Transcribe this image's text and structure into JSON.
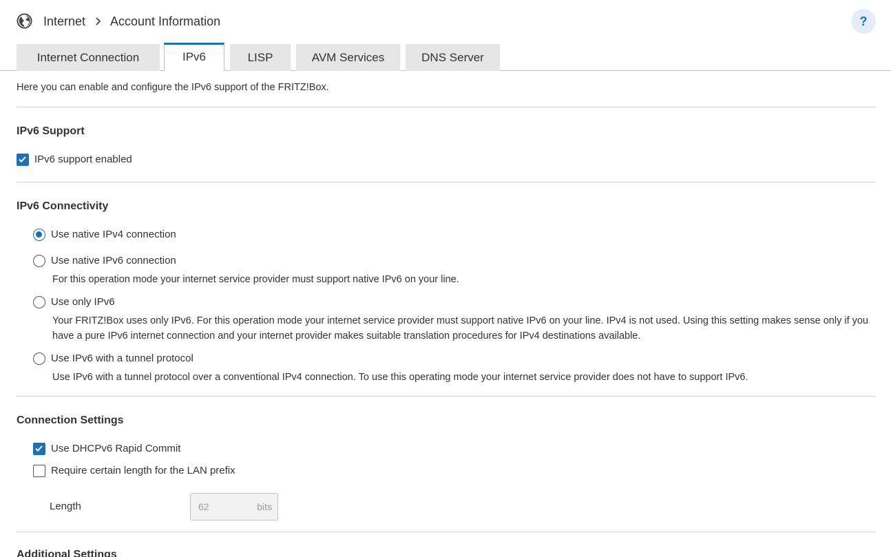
{
  "breadcrumb": {
    "root": "Internet",
    "current": "Account Information"
  },
  "help": {
    "label": "?"
  },
  "tabs": [
    {
      "label": "Internet Connection",
      "active": false
    },
    {
      "label": "IPv6",
      "active": true
    },
    {
      "label": "LISP",
      "active": false
    },
    {
      "label": "AVM Services",
      "active": false
    },
    {
      "label": "DNS Server",
      "active": false
    }
  ],
  "intro": "Here you can enable and configure the IPv6 support of the FRITZ!Box.",
  "ipv6_support": {
    "title": "IPv6 Support",
    "enabled_label": "IPv6 support enabled",
    "enabled_checked": true
  },
  "connectivity": {
    "title": "IPv6 Connectivity",
    "selected": "native_ipv4",
    "options": [
      {
        "id": "native_ipv4",
        "label": "Use native IPv4 connection",
        "desc": ""
      },
      {
        "id": "native_ipv6",
        "label": "Use native IPv6 connection",
        "desc": "For this operation mode your internet service provider must support native IPv6 on your line."
      },
      {
        "id": "only_ipv6",
        "label": "Use only IPv6",
        "desc": "Your FRITZ!Box uses only IPv6. For this operation mode your internet service provider must support native IPv6 on your line. IPv4 is not used. Using this setting makes sense only if you have a pure IPv6 internet connection and your internet provider makes suitable translation procedures for IPv4 destinations available."
      },
      {
        "id": "tunnel",
        "label": "Use IPv6 with a tunnel protocol",
        "desc": "Use IPv6 with a tunnel protocol over a conventional IPv4 connection. To use this operating mode your internet service provider does not have to support IPv6."
      }
    ]
  },
  "connection_settings": {
    "title": "Connection Settings",
    "rapid_commit_label": "Use DHCPv6 Rapid Commit",
    "rapid_commit_checked": true,
    "prefix_label": "Require certain length for the LAN prefix",
    "prefix_checked": false,
    "length_label": "Length",
    "length_value": "62",
    "length_unit": "bits"
  },
  "additional": {
    "title": "Additional Settings"
  },
  "colors": {
    "accent": "#1f6fb5",
    "help_bg": "#e3eef8",
    "tab_bg": "#e6e6e6",
    "divider": "#d0d0d0"
  },
  "icons": {
    "globe": "globe-icon",
    "chevron": "chevron-right-icon",
    "check": "check-icon"
  }
}
